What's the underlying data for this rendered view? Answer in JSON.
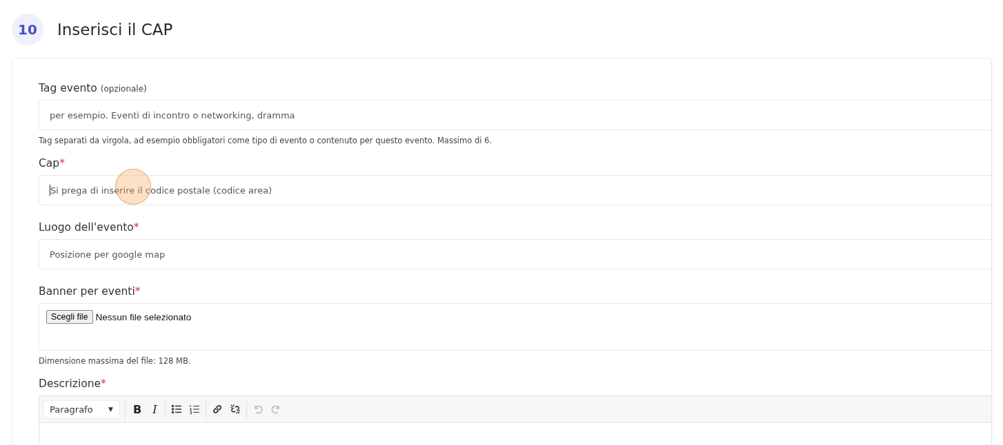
{
  "step": {
    "number": "10",
    "title": "Inserisci il CAP"
  },
  "fields": [
    {
      "kind": "text",
      "label": "Tag evento",
      "optional_note": "(opzionale)",
      "placeholder": "per esempio. Eventi di incontro o networking, dramma",
      "focused": false,
      "help": "Tag separati da virgola, ad esempio obbligatori come tipo di evento o contenuto per questo evento. Massimo di 6."
    },
    {
      "kind": "text",
      "label": "Cap",
      "required_mark": "*",
      "placeholder": "Si prega di inserire il codice postale (codice area)",
      "focused": true
    },
    {
      "kind": "text",
      "label": "Luogo dell'evento",
      "required_mark": "*",
      "placeholder": "Posizione per google map",
      "focused": false
    },
    {
      "kind": "file",
      "label": "Banner per eventi",
      "required_mark": "*",
      "button": "Scegli file",
      "status": "Nessun file selezionato",
      "help": "Dimensione massima del file: 128 MB."
    },
    {
      "kind": "editor",
      "label": "Descrizione",
      "required_mark": "*",
      "format": "Paragrafo",
      "caret": "▼",
      "groups": [
        [
          {
            "kind": "bold",
            "label": "B",
            "disabled": false
          },
          {
            "kind": "italic",
            "label": "I",
            "disabled": false
          }
        ],
        [
          {
            "kind": "bullet-list",
            "disabled": false
          },
          {
            "kind": "numbered-list",
            "disabled": false
          }
        ],
        [
          {
            "kind": "link",
            "disabled": false
          },
          {
            "kind": "unlink",
            "disabled": false
          }
        ],
        [
          {
            "kind": "undo",
            "disabled": true
          },
          {
            "kind": "redo",
            "disabled": true
          }
        ]
      ]
    }
  ]
}
